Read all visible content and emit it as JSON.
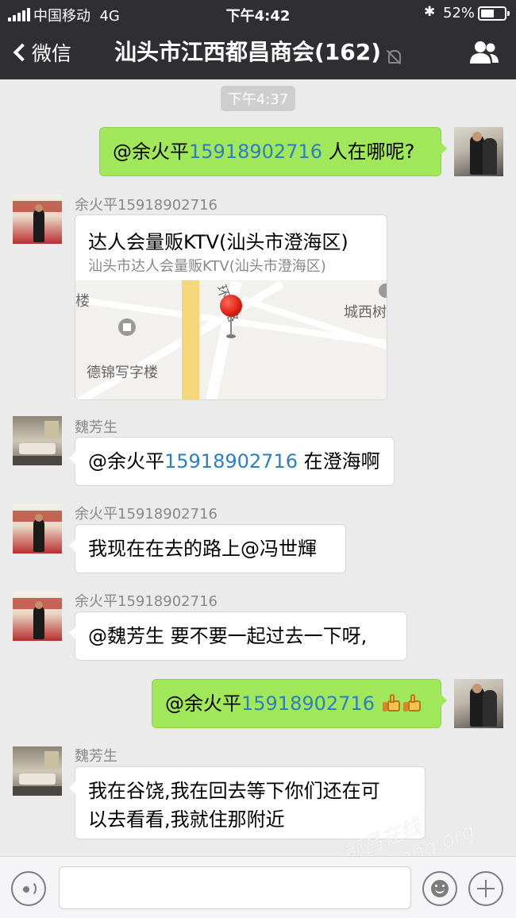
{
  "status_bar": {
    "carrier": "中国移动",
    "network": "4G",
    "time": "下午4:42",
    "battery": "52%",
    "battery_level": 0.52
  },
  "nav": {
    "back_label": "微信",
    "title": "汕头市江西都昌商会(162)"
  },
  "timestamp": "下午4:37",
  "messages": [
    {
      "side": "out",
      "mention": "@余火平",
      "phone": "15918902716",
      "text": " 人在哪呢?"
    },
    {
      "side": "in",
      "sender": "余火平15918902716",
      "type": "location",
      "location_title": "达人会量贩KTV(汕头市澄海区)",
      "location_address": "汕头市达人会量贩KTV(汕头市澄海区)",
      "map_labels": [
        "楼",
        "城西树",
        "德锦写字楼",
        "环西路"
      ]
    },
    {
      "side": "in",
      "sender": "魏芳生",
      "mention": "@余火平",
      "phone": "15918902716",
      "text": " 在澄海啊"
    },
    {
      "side": "in",
      "sender": "余火平15918902716",
      "text": "我现在在去的路上@冯世輝"
    },
    {
      "side": "in",
      "sender": "余火平15918902716",
      "text": "@魏芳生 要不要一起过去一下呀,"
    },
    {
      "side": "out",
      "mention": "@余火平",
      "phone": "15918902716",
      "emoji": [
        "thumbs-up",
        "thumbs-up"
      ]
    },
    {
      "side": "in",
      "sender": "魏芳生",
      "text_line1": "我在谷饶,我在回去等下你们还在可",
      "text_line2": "以去看看,我就住那附近"
    }
  ],
  "watermark": "都昌在线 duchang.org",
  "colors": {
    "nav_bg": "#2f2f33",
    "out_bubble": "#a0e75a",
    "phone_link": "#2c7fc2",
    "chat_bg": "#ebebeb"
  }
}
